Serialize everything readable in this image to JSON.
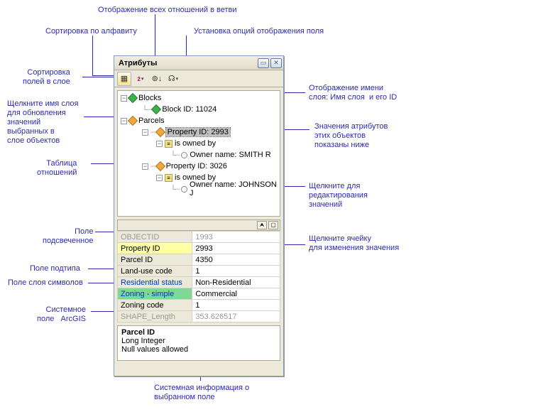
{
  "panel": {
    "title": "Атрибуты"
  },
  "toolbar": {
    "sort_layer": "⊞",
    "sort_alpha": "↓",
    "show_all": "⊚",
    "options": "☊"
  },
  "tree": {
    "blocks": {
      "label": "Blocks",
      "child": "Block ID: 11024"
    },
    "parcels": {
      "label": "Parcels",
      "p1": {
        "label": "Property ID: 2993",
        "rel": "is owned by",
        "owner": "Owner name: SMITH R"
      },
      "p2": {
        "label": "Property ID: 3026",
        "rel": "is owned by",
        "owner": "Owner name: JOHNSON J"
      }
    }
  },
  "grid": {
    "rows": [
      {
        "k": "OBJECTID",
        "v": "1993",
        "kclass": "sys",
        "vclass": "sys"
      },
      {
        "k": "Property ID",
        "v": "2993",
        "kclass": "hl",
        "vclass": ""
      },
      {
        "k": "Parcel ID",
        "v": "4350",
        "kclass": "",
        "vclass": ""
      },
      {
        "k": "Land-use code",
        "v": "1",
        "kclass": "",
        "vclass": ""
      },
      {
        "k": "Residential status",
        "v": "Non-Residential",
        "kclass": "sub",
        "vclass": ""
      },
      {
        "k": "Zoning - simple",
        "v": "Commercial",
        "kclass": "sym",
        "vclass": ""
      },
      {
        "k": "Zoning code",
        "v": "1",
        "kclass": "",
        "vclass": ""
      },
      {
        "k": "SHAPE_Length",
        "v": "353.626517",
        "kclass": "sys",
        "vclass": "sys"
      }
    ]
  },
  "info": {
    "heading": "Parcel ID",
    "type": "Long Integer",
    "nulls": "Null values allowed"
  },
  "callouts": {
    "sort_layer": "Сортировка\nполей в слое",
    "sort_alpha": "Сортировка по алфавиту",
    "show_all": "Отображение всех отношений в  ветви",
    "options": "Установка опций отображения поля",
    "layer_name": "Щелкните имя слоя\nдля обновления\nзначений\nвыбранных в\nслое объектов",
    "rel_table": "Таблица\nотношений",
    "disp_name": "Отображение имени\nслоя: Имя слоя  и его ID",
    "attr_vals": " Значения атрибутов\n этих объектов\n показаны ниже",
    "click_edit": "Щелкните для\nредактирования\nзначений",
    "click_cell": "Щелкните ячейку\nдля изменения значения",
    "hl_field": "Поле\nподсвеченное",
    "subtype": "Поле подтипа",
    "sym_layer": "Поле слоя символов",
    "sys_field": "Системное\nполе   ArcGIS",
    "sys_info": "Системная информация о\nвыбранном поле"
  }
}
